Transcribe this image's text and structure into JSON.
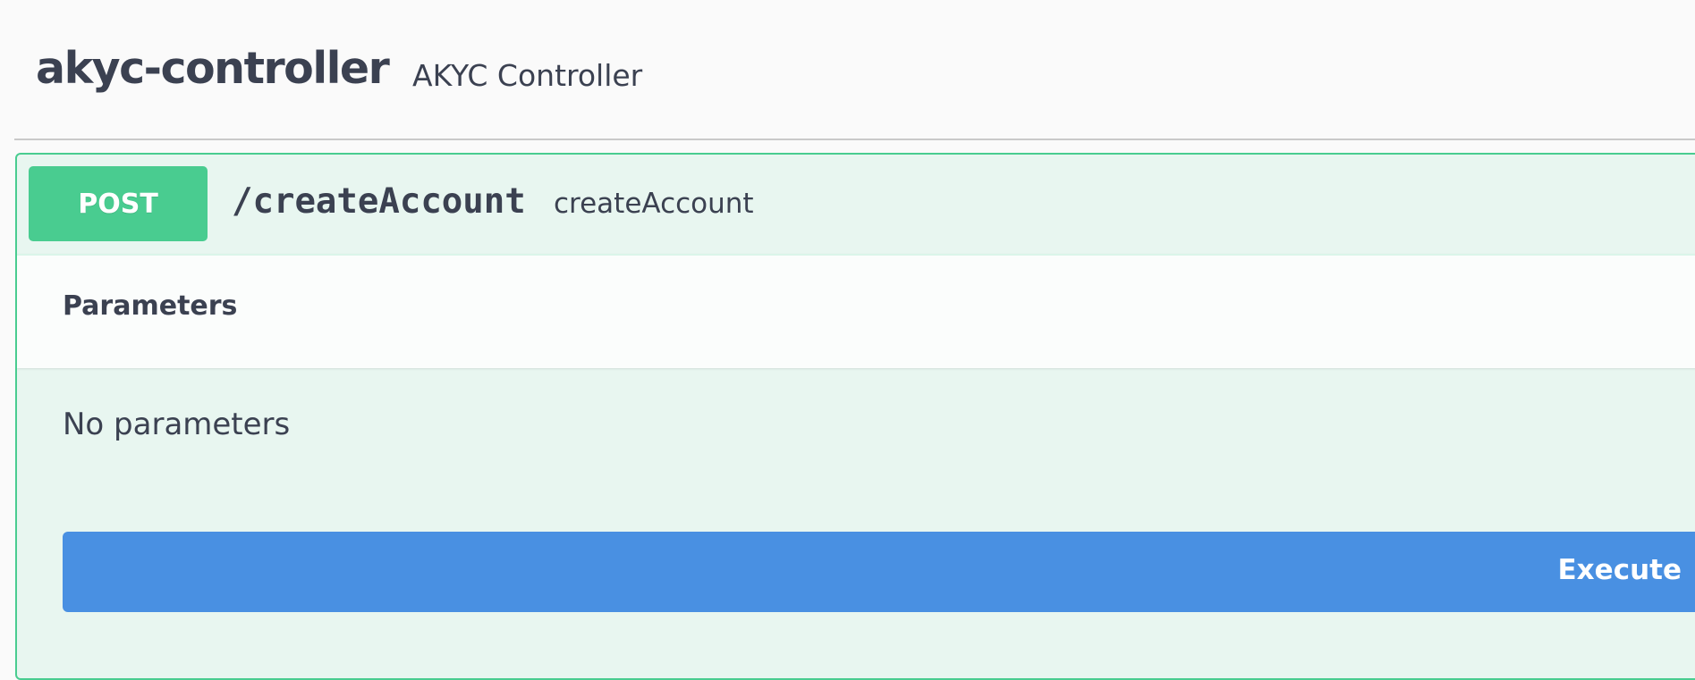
{
  "tag": {
    "name": "akyc-controller",
    "description": "AKYC Controller"
  },
  "operation": {
    "method": "POST",
    "path": "/createAccount",
    "summary": "createAccount",
    "color": "#49cc90",
    "background": "#e8f6f0"
  },
  "parameters": {
    "title": "Parameters",
    "empty_text": "No parameters"
  },
  "actions": {
    "execute_label": "Execute",
    "execute_color": "#4990e2"
  }
}
